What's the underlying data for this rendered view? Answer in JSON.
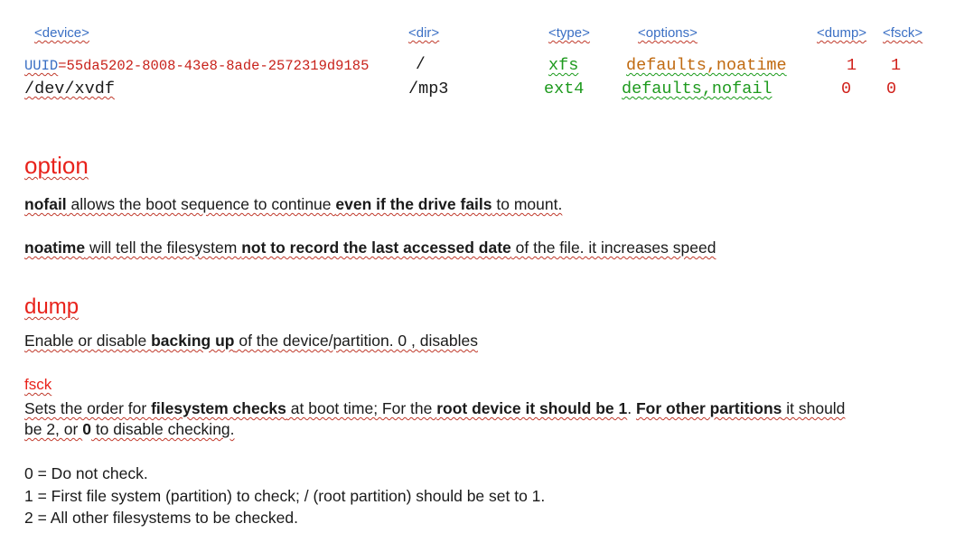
{
  "colors": {
    "header": "#3a6fc4",
    "uuid": "#c8221b",
    "green": "#1e9a1e",
    "orange": "#c06a10",
    "red_num": "#d0201a",
    "section": "#e8221b"
  },
  "header": {
    "device": "<device>",
    "dir": "<dir>",
    "type": "<type>",
    "options": "<options>",
    "dump": "<dump>",
    "fsck": "<fsck>"
  },
  "rows": [
    {
      "device_prefix": "UUID",
      "device_value": "=55da5202-8008-43e8-8ade-2572319d9185",
      "dir": "/",
      "type": "xfs",
      "options": "defaults,noatime",
      "dump": "1",
      "fsck": "1"
    },
    {
      "device": "/dev/xvdf",
      "dir": "/mp3",
      "type": "ext4",
      "options": "defaults,nofail",
      "dump": "0",
      "fsck": "0"
    }
  ],
  "option": {
    "title": "option",
    "nofail": {
      "t1": "nofail",
      "t2": " allows the boot sequence to continue ",
      "t3": "even if the drive fails",
      "t4": " to mount."
    },
    "noatime": {
      "t1": "noatime",
      "t2": " will tell the filesystem ",
      "t3": "not to record the last accessed date",
      "t4": " of the file. it increases speed"
    }
  },
  "dump": {
    "title": "dump",
    "t1": "Enable or disable ",
    "t2": "backing up",
    "t3": " of the device/partition. 0 , disables"
  },
  "fsck": {
    "title": "fsck",
    "line1": {
      "t1": "Sets the order for ",
      "t2": "filesystem checks",
      "t3": " at boot time; For the ",
      "t4": "root device it should be 1",
      "t5": ". ",
      "t6": "For other partitions",
      "t7": " it should"
    },
    "line2": {
      "t1": "be 2, or ",
      "t2": "0",
      "t3": " to disable checking."
    }
  },
  "values_list": [
    "0 = Do not check.",
    "1 = First file system (partition) to check; / (root partition) should be set to 1.",
    "2 = All other filesystems to be checked."
  ]
}
